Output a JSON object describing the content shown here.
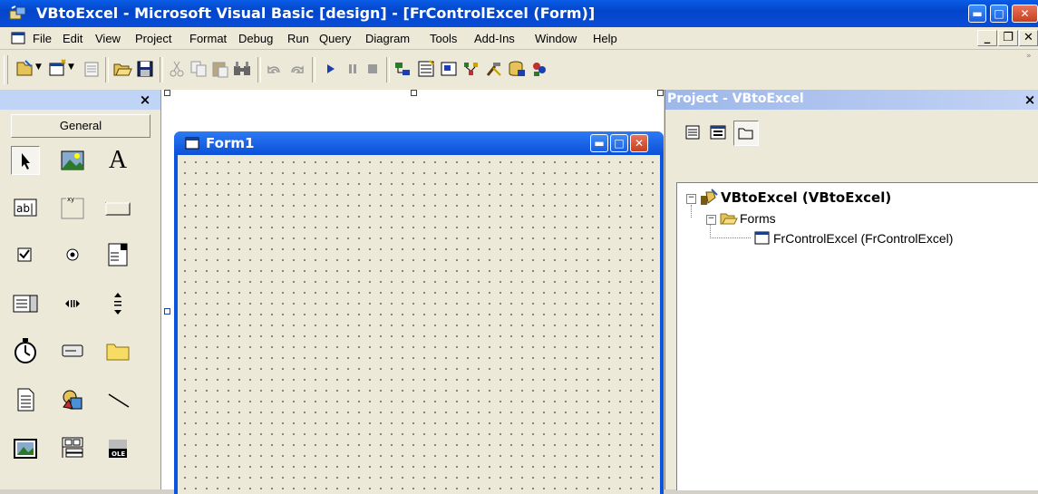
{
  "window": {
    "title": "VBtoExcel - Microsoft Visual Basic [design] - [FrControlExcel (Form)]",
    "app_icon": "vb-app-icon"
  },
  "menu": {
    "items": [
      "File",
      "Edit",
      "View",
      "Project",
      "Format",
      "Debug",
      "Run",
      "Query",
      "Diagram",
      "Tools",
      "Add-Ins",
      "Window",
      "Help"
    ],
    "mdi_controls": [
      "_",
      "❐",
      "✕"
    ]
  },
  "toolbar": {
    "icons": [
      "add-project-icon",
      "add-form-icon",
      "menu-editor-icon",
      "open-project-icon",
      "save-project-icon",
      "cut-icon",
      "copy-icon",
      "paste-icon",
      "find-icon",
      "undo-icon",
      "redo-icon",
      "start-icon",
      "break-icon",
      "end-icon",
      "project-explorer-icon",
      "properties-window-icon",
      "form-layout-icon",
      "object-browser-icon",
      "toolbox-icon",
      "data-view-icon",
      "component-manager-icon"
    ]
  },
  "toolbox": {
    "close_label": "×",
    "tab_label": "General",
    "tools": [
      "pointer",
      "picturebox",
      "label",
      "textbox",
      "frame",
      "commandbutton",
      "checkbox",
      "optionbutton",
      "combobox",
      "listbox",
      "hscrollbar",
      "vscrollbar",
      "timer",
      "drivelistbox",
      "dirlistbox",
      "filelistbox",
      "shape",
      "line",
      "image",
      "data",
      "ole"
    ]
  },
  "form": {
    "title": "Form1"
  },
  "project": {
    "title": "Project - VBtoExcel",
    "close_label": "×",
    "tree": {
      "root": "VBtoExcel (VBtoExcel)",
      "folder": "Forms",
      "item": "FrControlExcel (FrControlExcel)"
    }
  },
  "colors": {
    "titlebar": "#0245c9",
    "face": "#ece9d8",
    "form_titlebar": "#2c7af5"
  }
}
